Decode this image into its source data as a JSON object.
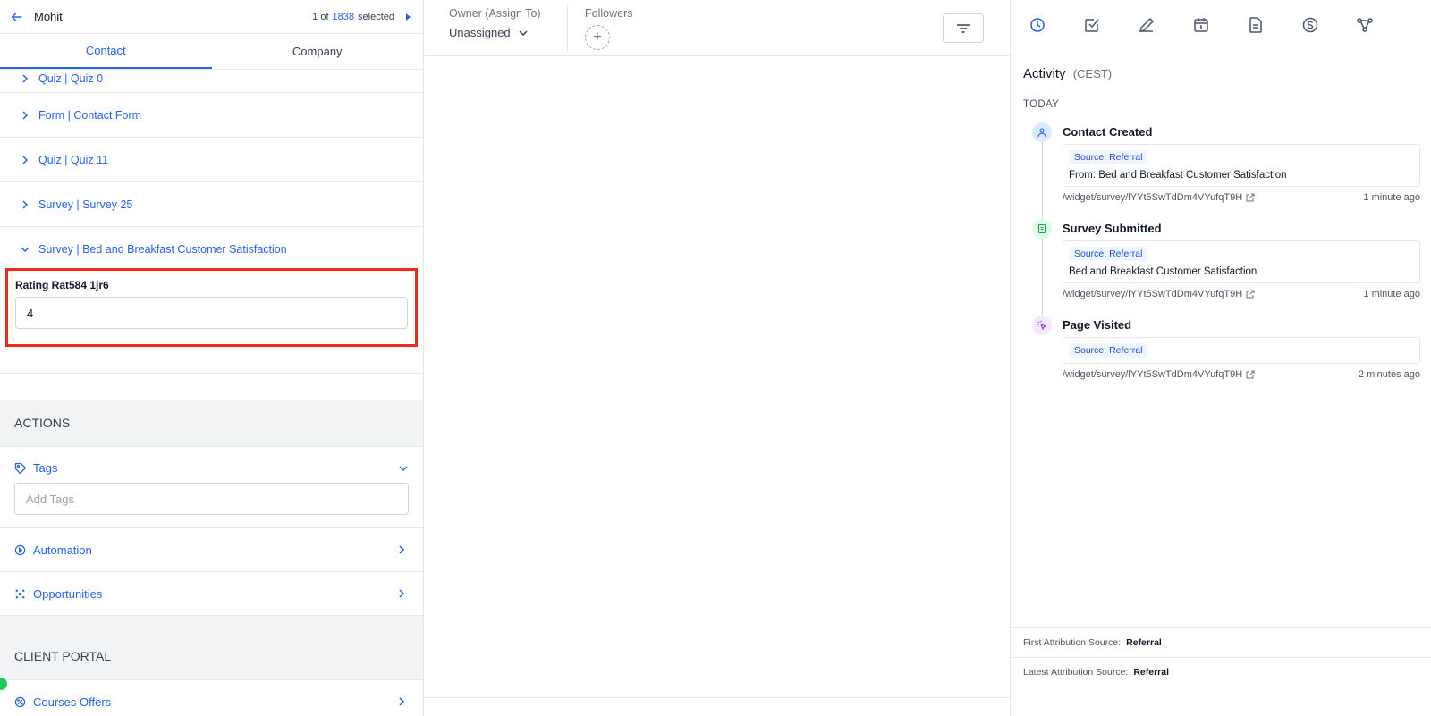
{
  "left": {
    "contact_name": "Mohit",
    "pager": {
      "position": "1 of",
      "total": "1838",
      "selected": "selected"
    },
    "tabs": [
      {
        "label": "Contact"
      },
      {
        "label": "Company"
      }
    ],
    "accordion": [
      {
        "label": "Quiz | Quiz 0"
      },
      {
        "label": "Form | Contact Form"
      },
      {
        "label": "Quiz | Quiz 11"
      },
      {
        "label": "Survey | Survey 25"
      },
      {
        "label": "Survey | Bed and Breakfast Customer Satisfaction"
      }
    ],
    "field": {
      "label": "Rating Rat584 1jr6",
      "value": "4"
    },
    "actions_title": "ACTIONS",
    "tags": {
      "label": "Tags",
      "placeholder": "Add Tags"
    },
    "automation": "Automation",
    "opportunities": "Opportunities",
    "client_portal_title": "CLIENT PORTAL",
    "courses": "Courses Offers"
  },
  "middle": {
    "owner_label": "Owner (Assign To)",
    "owner_value": "Unassigned",
    "followers_label": "Followers",
    "add_follower": "+"
  },
  "right": {
    "activity_title": "Activity",
    "timezone": "(CEST)",
    "day": "TODAY",
    "events": [
      {
        "title": "Contact Created",
        "source": "Source: Referral",
        "text": "From: Bed and Breakfast Customer Satisfaction",
        "url": "/widget/survey/lYYt5SwTdDm4VYufqT9H",
        "time": "1 minute ago",
        "icon": "user-icon"
      },
      {
        "title": "Survey Submitted",
        "source": "Source: Referral",
        "text": "Bed and Breakfast Customer Satisfaction",
        "url": "/widget/survey/lYYt5SwTdDm4VYufqT9H",
        "time": "1 minute ago",
        "icon": "document-icon"
      },
      {
        "title": "Page Visited",
        "source": "Source: Referral",
        "text": "",
        "url": "/widget/survey/lYYt5SwTdDm4VYufqT9H",
        "time": "2 minutes ago",
        "icon": "click-icon"
      }
    ],
    "first_attr_label": "First Attribution Source:",
    "first_attr_value": "Referral",
    "latest_attr_label": "Latest Attribution Source:",
    "latest_attr_value": "Referral"
  },
  "colors": {
    "accent": "#2563eb",
    "highlight": "#ef2a1a",
    "status_green": "#22c55e"
  }
}
